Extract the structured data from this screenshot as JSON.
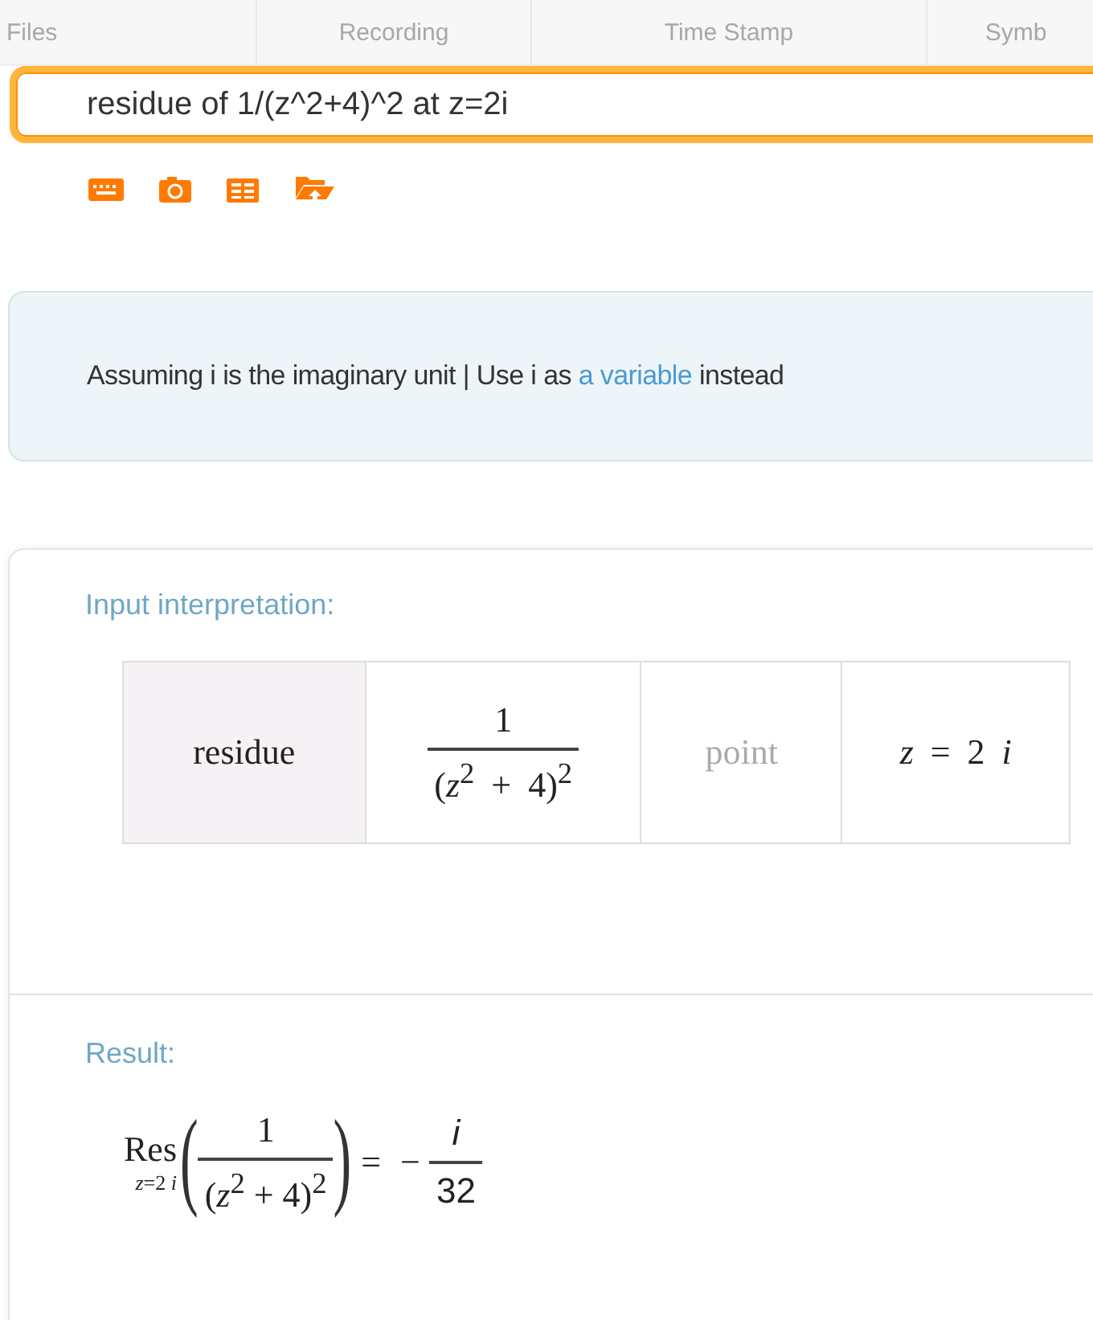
{
  "header_columns": [
    "Files",
    "Recording",
    "Time Stamp",
    "Symb"
  ],
  "query": {
    "value": "residue of 1/(z^2+4)^2 at z=2i"
  },
  "tools": [
    {
      "kind": "keyboard"
    },
    {
      "kind": "camera"
    },
    {
      "kind": "table"
    },
    {
      "kind": "upload"
    }
  ],
  "assumption": {
    "text": "Assuming i is the imaginary unit | Use i as ",
    "link": "a variable",
    "after": " instead"
  },
  "input_interpretation": {
    "title": "Input interpretation:",
    "cells": [
      {
        "kind": "label",
        "text": "residue"
      },
      {
        "kind": "fraction",
        "numerator": "1",
        "denominator": "(*z*$^{2}$ + 4)$^{2}$"
      },
      {
        "kind": "hint",
        "text": "point"
      },
      {
        "kind": "math",
        "text": "*z* = 2 *i*"
      }
    ]
  },
  "result": {
    "title": "Result:",
    "operator": "Res",
    "subscript": "*z*=2 *i*",
    "left_paren": "(",
    "numerator": "1",
    "denominator": "(*z*$^{2}$ + 4)$^{2}$",
    "right_paren": ")",
    "equals": "=",
    "sign": "−",
    "value_numerator": "*i*",
    "value_denominator": "32"
  }
}
